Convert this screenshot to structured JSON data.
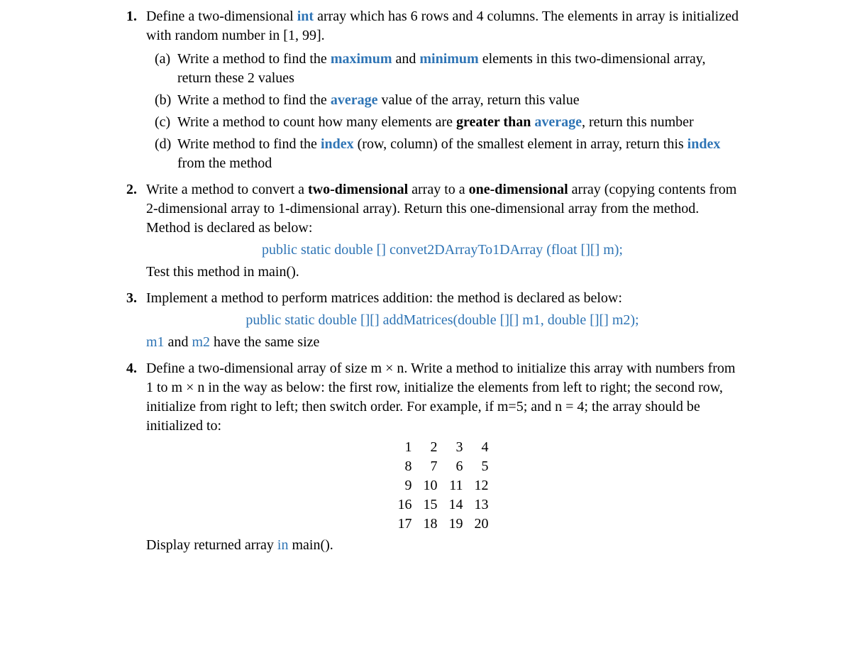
{
  "q1": {
    "intro_pre": "Define a two-dimensional ",
    "kw_int": "int",
    "intro_post": " array which has 6 rows and 4 columns. The elements in array is initialized with random number in [1, 99].",
    "a": {
      "label": "(a)",
      "t1": "Write a method to find the ",
      "kw_max": "maximum",
      "t2": " and ",
      "kw_min": "minimum",
      "t3": " elements in this two-dimensional array, return these 2 values"
    },
    "b": {
      "label": "(b)",
      "t1": "Write a method to find the ",
      "kw_avg": "average",
      "t2": " value of the array, return this value"
    },
    "c": {
      "label": "(c)",
      "t1": "Write a method to count how many elements are ",
      "bold_gt": "greater than ",
      "kw_avg": "average",
      "t2": ", return this number"
    },
    "d": {
      "label": "(d)",
      "t1": "Write method to find the ",
      "kw_index1": "index",
      "t2": " (row, column) of the smallest element in array, return this ",
      "kw_index2": "index",
      "t3": " from the method"
    }
  },
  "q2": {
    "t1": "Write a method to convert a ",
    "b_two": "two-dimensional",
    "t2": " array to a ",
    "b_one": "one-dimensional",
    "t3": " array (copying contents from 2-dimensional array to 1-dimensional array). Return this one-dimensional array from the method. Method is declared as below:",
    "code": "public static double [] convet2DArrayTo1DArray (float [][] m);",
    "t4": "Test this method in main()."
  },
  "q3": {
    "t1": "Implement a method to perform matrices addition: the method is declared as below:",
    "code": "public static double [][] addMatrices(double [][] m1,  double [][] m2);",
    "t2a": "m1",
    "t2b": " and ",
    "t2c": "m2",
    "t2d": " have the same size"
  },
  "q4": {
    "t1": "Define a two-dimensional array of size m × n. Write a method to initialize this array with numbers from 1 to m × n in the way as below: the first row, initialize the elements from left to right; the second row, initialize from right to left; then switch order. For example, if m=5; and n = 4; the array should be initialized to:",
    "matrix": [
      [
        1,
        2,
        3,
        4
      ],
      [
        8,
        7,
        6,
        5
      ],
      [
        9,
        10,
        11,
        12
      ],
      [
        16,
        15,
        14,
        13
      ],
      [
        17,
        18,
        19,
        20
      ]
    ],
    "t2a": "Display returned array ",
    "kw_in": "in",
    "t2b": " main()."
  }
}
